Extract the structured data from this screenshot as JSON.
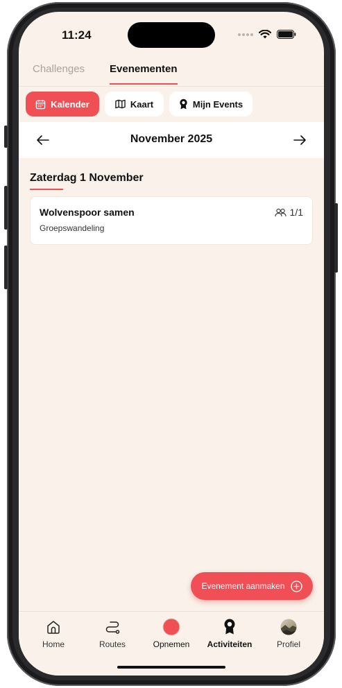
{
  "status_bar": {
    "time": "11:24"
  },
  "top_tabs": [
    {
      "label": "Challenges",
      "active": false
    },
    {
      "label": "Evenementen",
      "active": true
    }
  ],
  "filters": [
    {
      "label": "Kalender",
      "icon": "calendar-icon",
      "active": true
    },
    {
      "label": "Kaart",
      "icon": "map-icon",
      "active": false
    },
    {
      "label": "Mijn Events",
      "icon": "badge-icon",
      "active": false
    }
  ],
  "month_nav": {
    "label": "November 2025"
  },
  "day": {
    "heading": "Zaterdag 1 November"
  },
  "events": [
    {
      "title": "Wolvenspoor samen",
      "subtitle": "Groepswandeling",
      "count": "1/1"
    }
  ],
  "fab": {
    "label": "Evenement aanmaken"
  },
  "bottom_nav": [
    {
      "label": "Home",
      "icon": "home-icon",
      "active": false
    },
    {
      "label": "Routes",
      "icon": "routes-icon",
      "active": false
    },
    {
      "label": "Opnemen",
      "icon": "record-icon",
      "active": false
    },
    {
      "label": "Activiteiten",
      "icon": "award-icon",
      "active": true
    },
    {
      "label": "Profiel",
      "icon": "avatar",
      "active": false
    }
  ],
  "colors": {
    "accent": "#ef4f55",
    "background": "#faf2ea",
    "surface": "#ffffff",
    "text": "#111111"
  }
}
